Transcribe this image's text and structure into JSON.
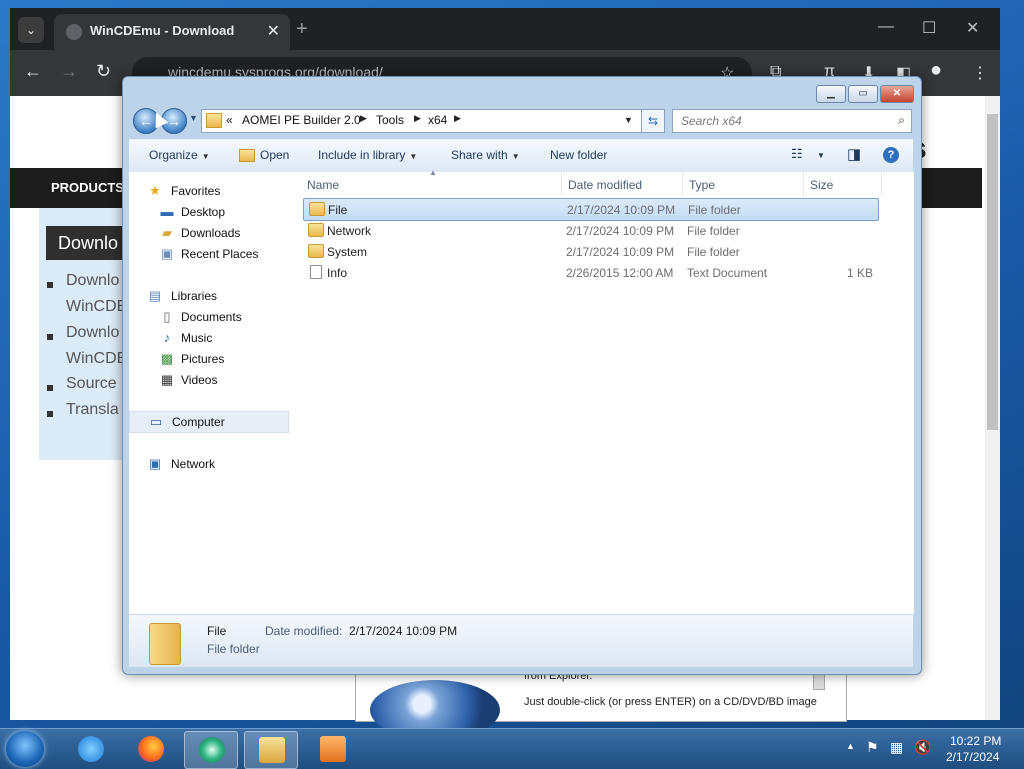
{
  "browser": {
    "tab_title": "WinCDEmu - Download",
    "tab_close": "✕",
    "new_tab": "+",
    "url": "wincdemu.sysprogs.org/download/",
    "site_nav_label": "PRODUCTS",
    "download_heading": "Downlo",
    "page_links": [
      "Downlo",
      "WinCDE",
      "Downlo",
      "WinCDE",
      "Source",
      "Transla"
    ],
    "image_caption_1": "from Explorer.",
    "image_caption_2": "Just double-click (or press ENTER) on a CD/DVD/BD image",
    "page_heading_fragment": "s"
  },
  "explorer": {
    "address": {
      "overflow": "«",
      "crumbs": [
        "AOMEI PE Builder 2.0",
        "Tools",
        "x64"
      ]
    },
    "search_placeholder": "Search x64",
    "toolbar": {
      "organize": "Organize",
      "open": "Open",
      "include_in_library": "Include in library",
      "share_with": "Share with",
      "new_folder": "New folder"
    },
    "nav": {
      "favorites": "Favorites",
      "desktop": "Desktop",
      "downloads": "Downloads",
      "recent_places": "Recent Places",
      "libraries": "Libraries",
      "documents": "Documents",
      "music": "Music",
      "pictures": "Pictures",
      "videos": "Videos",
      "computer": "Computer",
      "network": "Network"
    },
    "columns": {
      "name": "Name",
      "date_modified": "Date modified",
      "type": "Type",
      "size": "Size"
    },
    "files": [
      {
        "name": "File",
        "date": "2/17/2024 10:09 PM",
        "type": "File folder",
        "size": "",
        "icon": "folder-icon"
      },
      {
        "name": "Network",
        "date": "2/17/2024 10:09 PM",
        "type": "File folder",
        "size": "",
        "icon": "folder-icon"
      },
      {
        "name": "System",
        "date": "2/17/2024 10:09 PM",
        "type": "File folder",
        "size": "",
        "icon": "folder-icon"
      },
      {
        "name": "Info",
        "date": "2/26/2015 12:00 AM",
        "type": "Text Document",
        "size": "1 KB",
        "icon": "text-document-icon"
      }
    ],
    "details": {
      "name": "File",
      "date_label": "Date modified:",
      "date_value": "2/17/2024 10:09 PM",
      "type": "File folder"
    }
  },
  "taskbar": {
    "time": "10:22 PM",
    "date": "2/17/2024"
  }
}
